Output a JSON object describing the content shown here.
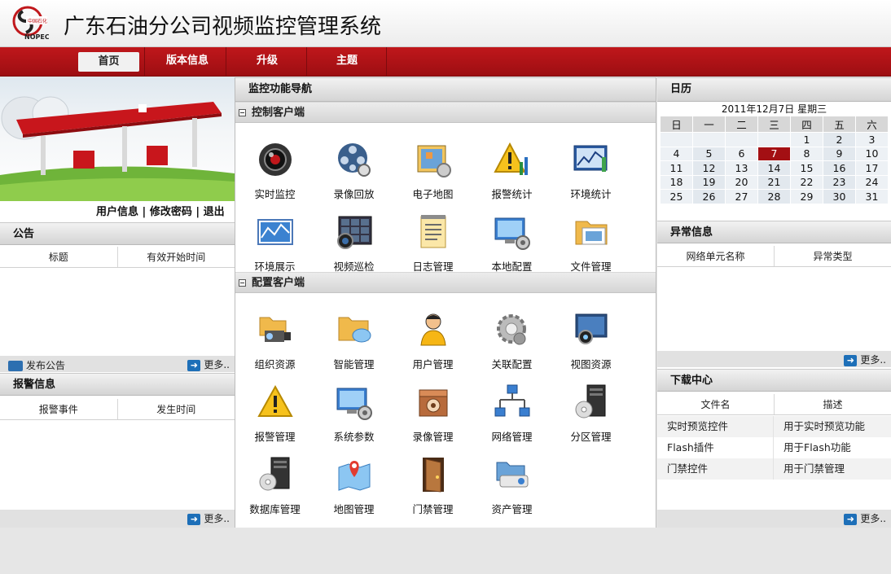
{
  "app": {
    "title": "广东石油分公司视频监控管理系统"
  },
  "nav": {
    "items": [
      "首页",
      "版本信息",
      "升级",
      "主题"
    ]
  },
  "user_links": {
    "info": "用户信息",
    "password": "修改密码",
    "logout": "退出",
    "sep": "|"
  },
  "notice": {
    "title": "公告",
    "columns": [
      "标题",
      "有效开始时间"
    ],
    "publish_label": "发布公告",
    "more_label": "更多.."
  },
  "alarm": {
    "title": "报警信息",
    "columns": [
      "报警事件",
      "发生时间"
    ],
    "more_label": "更多.."
  },
  "mid": {
    "title": "监控功能导航",
    "sections": [
      {
        "title": "控制客户端",
        "tiles": [
          "实时监控",
          "录像回放",
          "电子地图",
          "报警统计",
          "环境统计",
          "环境展示",
          "视频巡检",
          "日志管理",
          "本地配置",
          "文件管理"
        ]
      },
      {
        "title": "配置客户端",
        "tiles": [
          "组织资源",
          "智能管理",
          "用户管理",
          "关联配置",
          "视图资源",
          "报警管理",
          "系统参数",
          "录像管理",
          "网络管理",
          "分区管理",
          "数据库管理",
          "地图管理",
          "门禁管理",
          "资产管理"
        ]
      }
    ]
  },
  "calendar": {
    "title": "日历",
    "header": "2011年12月7日  星期三",
    "weekdays": [
      "日",
      "一",
      "二",
      "三",
      "四",
      "五",
      "六"
    ],
    "weeks": [
      [
        "",
        "",
        "",
        "",
        "1",
        "2",
        "3"
      ],
      [
        "4",
        "5",
        "6",
        "7",
        "8",
        "9",
        "10"
      ],
      [
        "11",
        "12",
        "13",
        "14",
        "15",
        "16",
        "17"
      ],
      [
        "18",
        "19",
        "20",
        "21",
        "22",
        "23",
        "24"
      ],
      [
        "25",
        "26",
        "27",
        "28",
        "29",
        "30",
        "31"
      ]
    ],
    "today": "7"
  },
  "abnormal": {
    "title": "异常信息",
    "columns": [
      "网络单元名称",
      "异常类型"
    ],
    "more_label": "更多.."
  },
  "download": {
    "title": "下载中心",
    "columns": [
      "文件名",
      "描述"
    ],
    "rows": [
      {
        "name": "实时预览控件",
        "desc": "用于实时预览功能"
      },
      {
        "name": "Flash插件",
        "desc": "用于Flash功能"
      },
      {
        "name": "门禁控件",
        "desc": "用于门禁管理"
      }
    ],
    "more_label": "更多.."
  },
  "colors": {
    "brand_red": "#a30f13",
    "nav_red": "#b3141a",
    "accent_blue": "#1d6fb8"
  }
}
